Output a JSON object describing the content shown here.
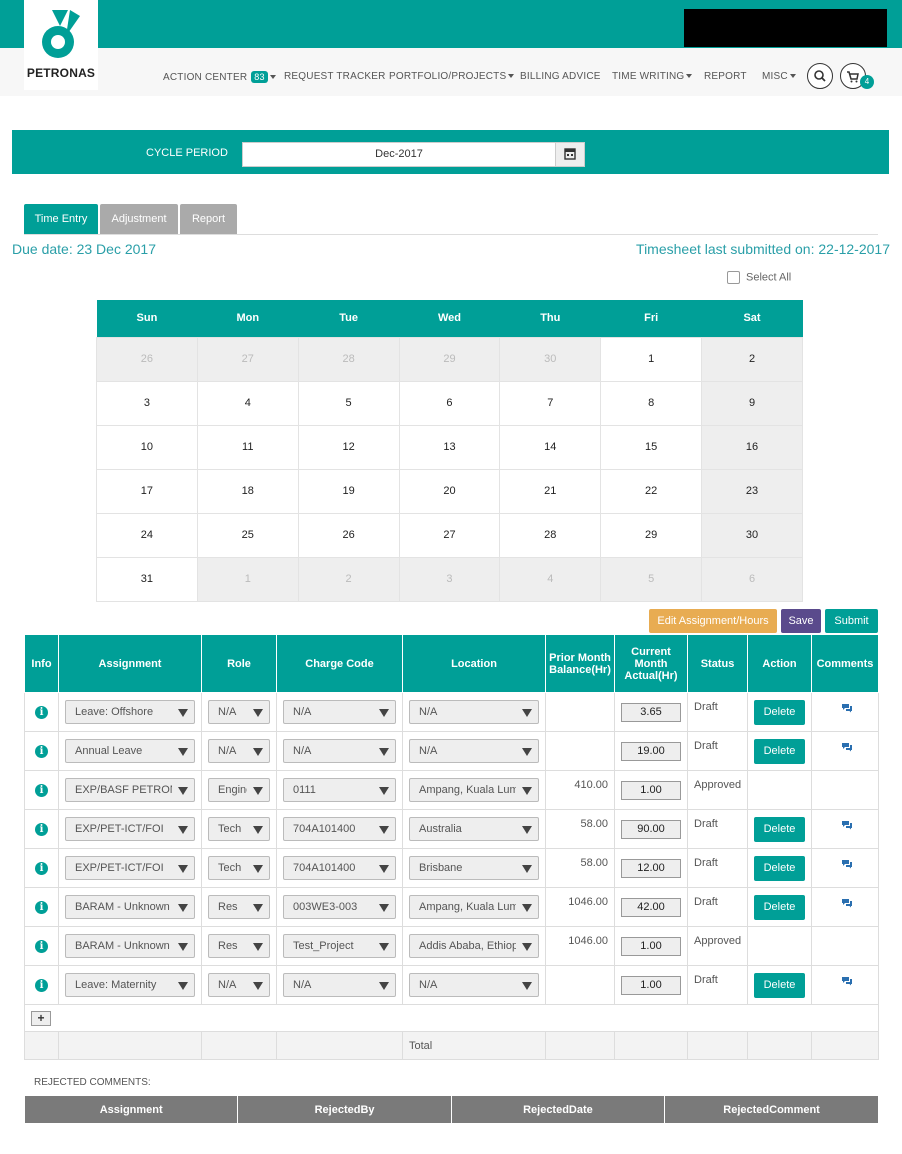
{
  "brand": {
    "name": "PETRONAS"
  },
  "nav": {
    "action_center": "ACTION CENTER",
    "action_center_count": "83",
    "request_tracker": "REQUEST TRACKER",
    "portfolio": "PORTFOLIO/PROJECTS",
    "billing": "BILLING ADVICE",
    "time_writing": "TIME WRITING",
    "report": "REPORT",
    "misc": "MISC",
    "cart_count": "4"
  },
  "cycle": {
    "label": "CYCLE PERIOD",
    "value": "Dec-2017"
  },
  "tabs": [
    "Time Entry",
    "Adjustment",
    "Report"
  ],
  "due_date": "Due date: 23 Dec 2017",
  "last_submitted": "Timesheet last submitted on: 22-12-2017",
  "select_all": "Select All",
  "calendar": {
    "days": [
      "Sun",
      "Mon",
      "Tue",
      "Wed",
      "Thu",
      "Fri",
      "Sat"
    ],
    "weeks": [
      [
        "26",
        "27",
        "28",
        "29",
        "30",
        "1",
        "2"
      ],
      [
        "3",
        "4",
        "5",
        "6",
        "7",
        "8",
        "9"
      ],
      [
        "10",
        "11",
        "12",
        "13",
        "14",
        "15",
        "16"
      ],
      [
        "17",
        "18",
        "19",
        "20",
        "21",
        "22",
        "23"
      ],
      [
        "24",
        "25",
        "26",
        "27",
        "28",
        "29",
        "30"
      ],
      [
        "31",
        "1",
        "2",
        "3",
        "4",
        "5",
        "6"
      ]
    ]
  },
  "actions": {
    "edit": "Edit Assignment/Hours",
    "save": "Save",
    "submit": "Submit"
  },
  "grid": {
    "headers": [
      "Info",
      "Assignment",
      "Role",
      "Charge Code",
      "Location",
      "Prior Month Balance(Hr)",
      "Current Month Actual(Hr)",
      "Status",
      "Action",
      "Comments"
    ],
    "delete_label": "Delete",
    "total_label": "Total",
    "rows": [
      {
        "assignment": "Leave: Offshore",
        "role": "N/A",
        "charge": "N/A",
        "location": "N/A",
        "prior": "",
        "current": "3.65",
        "status": "Draft",
        "delete": true,
        "comment": true
      },
      {
        "assignment": "Annual Leave",
        "role": "N/A",
        "charge": "N/A",
        "location": "N/A",
        "prior": "",
        "current": "19.00",
        "status": "Draft",
        "delete": true,
        "comment": true
      },
      {
        "assignment": "EXP/BASF PETRONAS",
        "role": "Engineer",
        "charge": "0111",
        "location": "Ampang, Kuala Lumpur",
        "prior": "410.00",
        "current": "1.00",
        "status": "Approved",
        "delete": false,
        "comment": false
      },
      {
        "assignment": "EXP/PET-ICT/FOI",
        "role": "Tech",
        "charge": "704A101400",
        "location": "Australia",
        "prior": "58.00",
        "current": "90.00",
        "status": "Draft",
        "delete": true,
        "comment": true
      },
      {
        "assignment": "EXP/PET-ICT/FOI",
        "role": "Tech",
        "charge": "704A101400",
        "location": "Brisbane",
        "prior": "58.00",
        "current": "12.00",
        "status": "Draft",
        "delete": true,
        "comment": true
      },
      {
        "assignment": "BARAM - Unknown",
        "role": "Res",
        "charge": "003WE3-003",
        "location": "Ampang, Kuala Lumpur",
        "prior": "1046.00",
        "current": "42.00",
        "status": "Draft",
        "delete": true,
        "comment": true
      },
      {
        "assignment": "BARAM - Unknown",
        "role": "Res",
        "charge": "Test_Project",
        "location": "Addis Ababa, Ethiopia",
        "prior": "1046.00",
        "current": "1.00",
        "status": "Approved",
        "delete": false,
        "comment": false
      },
      {
        "assignment": "Leave: Maternity",
        "role": "N/A",
        "charge": "N/A",
        "location": "N/A",
        "prior": "",
        "current": "1.00",
        "status": "Draft",
        "delete": true,
        "comment": true
      }
    ]
  },
  "rejected": {
    "label": "REJECTED COMMENTS:",
    "headers": [
      "Assignment",
      "RejectedBy",
      "RejectedDate",
      "RejectedComment"
    ]
  },
  "colors": {
    "brand": "#009f97",
    "edit": "#e8ac52",
    "save": "#5a4a8c",
    "reject_header": "#7a7a7a"
  }
}
